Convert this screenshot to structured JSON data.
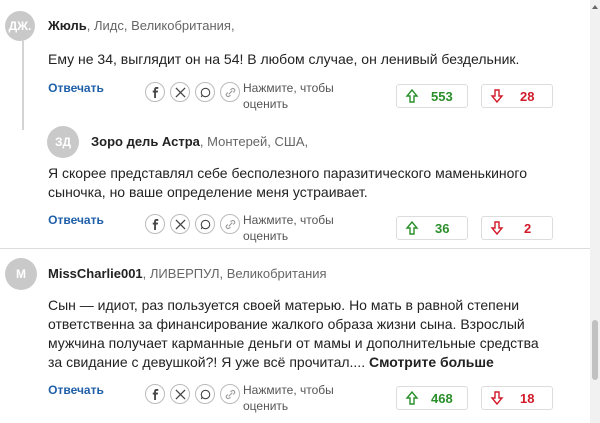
{
  "comments": [
    {
      "avatar": "ДЖ.",
      "name": "Жюль",
      "location": ", Лидс, Великобритания,",
      "text": "Ему не 34, выглядит он на 54! В любом случае, он ленивый бездельник.",
      "reply_label": "Отвечать",
      "rate_label": "Нажмите, чтобы оценить",
      "upvotes": "553",
      "downvotes": "28"
    },
    {
      "avatar": "ЗД",
      "name": "Зоро дель Астра",
      "location": ", Монтерей, США,",
      "text": "Я скорее представлял себе бесполезного паразитического маменькиного сыночка, но ваше определение меня устраивает.",
      "reply_label": "Отвечать",
      "rate_label": "Нажмите, чтобы оценить",
      "upvotes": "36",
      "downvotes": "2"
    },
    {
      "avatar": "M",
      "name": "MissCharlie001",
      "location": ", ЛИВЕРПУЛ, Великобритания",
      "text": "Сын — идиот, раз пользуется своей матерью. Но мать в равной степени ответственна за финансирование жалкого образа жизни сына. Взрослый мужчина получает карманные деньги от мамы и дополнительные средства за свидание с девушкой?! Я уже всё прочитал.... ",
      "more_label": "Смотрите больше",
      "reply_label": "Отвечать",
      "rate_label": "Нажмите, чтобы оценить",
      "upvotes": "468",
      "downvotes": "18"
    }
  ],
  "share_icons": [
    "facebook-icon",
    "x-icon",
    "whatsapp-icon",
    "link-icon"
  ],
  "colors": {
    "reply": "#1f5fa8",
    "up": "#2a8f2a",
    "down": "#d11b2a"
  }
}
